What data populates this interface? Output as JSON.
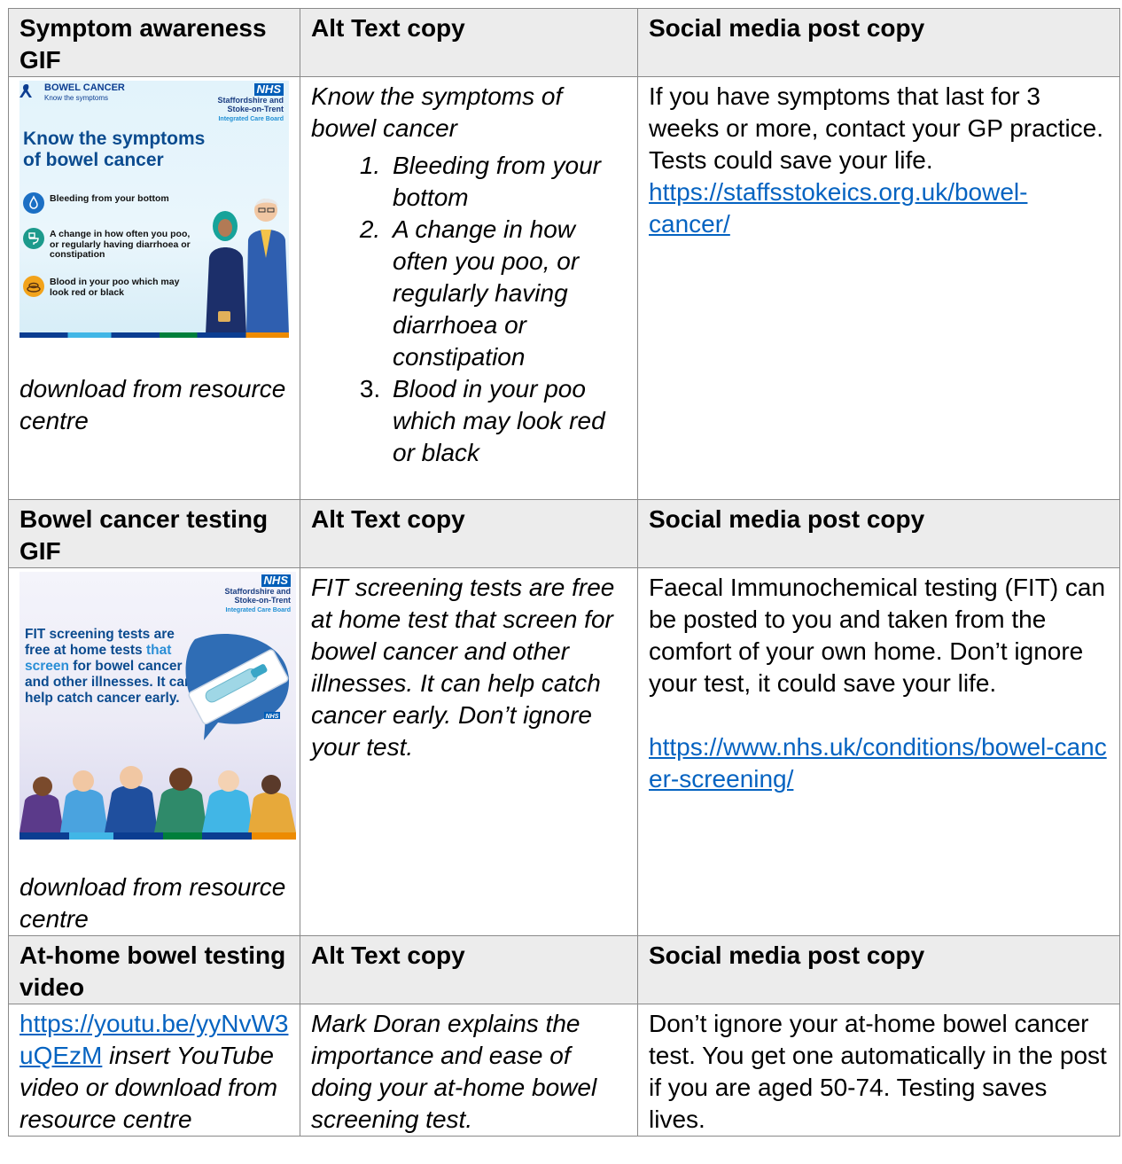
{
  "rows": [
    {
      "header": {
        "col1": "Symptom awareness GIF",
        "col2": "Alt Text copy",
        "col3": "Social media post copy"
      },
      "graphic": {
        "brand_title": "BOWEL CANCER",
        "brand_sub": "Know the symptoms",
        "nhs_logo": "NHS",
        "nhs_org_1": "Staffordshire and",
        "nhs_org_2": "Stoke-on-Trent",
        "nhs_org_3": "Integrated Care Board",
        "headline_1": "Know the symptoms",
        "headline_2": "of bowel cancer",
        "items": [
          "Bleeding from your bottom",
          "A change in how often you poo, or regularly having diarrhoea or constipation",
          "Blood in your poo which may look red or black"
        ]
      },
      "download_note": "download from resource centre",
      "alt_text_intro": "Know the symptoms of bowel cancer",
      "alt_text_list": [
        "Bleeding from your bottom",
        "A change in how often you poo, or regularly having diarrhoea or constipation",
        "Blood in your poo which may look red or black"
      ],
      "post_text": "If you have symptoms that last for 3 weeks or more, contact your GP practice. Tests could save your life.",
      "post_link": "https://staffsstokeics.org.uk/bowel-cancer/"
    },
    {
      "header": {
        "col1": "Bowel cancer testing GIF",
        "col2": "Alt Text copy",
        "col3": "Social media post copy"
      },
      "graphic": {
        "nhs_logo": "NHS",
        "nhs_org_1": "Staffordshire and",
        "nhs_org_2": "Stoke-on-Trent",
        "nhs_org_3": "Integrated Care Board",
        "text_a": "FIT screening tests are free at home tests",
        "text_b": "that screen",
        "text_c": "for bowel cancer and other illnesses. It can help catch cancer early.",
        "kit_logo": "NHS"
      },
      "download_note": "download from resource centre",
      "alt_text": "FIT screening tests are free at home test that screen for bowel cancer and other illnesses. It can help catch cancer early. Don’t ignore your test.",
      "post_text": "Faecal Immunochemical testing (FIT) can be posted to you and taken from the comfort of your own home. Don’t ignore your test, it could save your life.",
      "post_link": "https://www.nhs.uk/conditions/bowel-cancer-screening/"
    },
    {
      "header": {
        "col1": "At-home bowel testing video",
        "col2": "Alt Text copy",
        "col3": "Social media post copy"
      },
      "video_link": "https://youtu.be/yyNvW3uQEzM",
      "video_note": "insert YouTube video or download from resource centre",
      "alt_text": "Mark Doran explains the importance and ease of doing your at-home bowel screening test.",
      "post_text": "Don’t ignore your at-home bowel cancer test. You get one automatically in the post if you are aged 50-74. Testing saves lives."
    }
  ],
  "colors": {
    "link": "#0563c1",
    "header_bg": "#ececec",
    "nhs_blue": "#005eb8",
    "graphic_heading": "#0b4b8f"
  }
}
